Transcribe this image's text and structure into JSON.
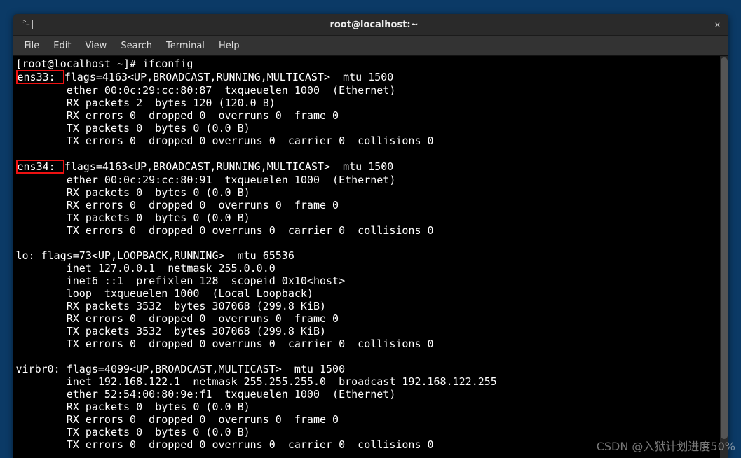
{
  "titlebar": {
    "title": "root@localhost:~"
  },
  "menu": {
    "file": "File",
    "edit": "Edit",
    "view": "View",
    "search": "Search",
    "terminal": "Terminal",
    "help": "Help"
  },
  "term": {
    "prompt": "[root@localhost ~]# ",
    "command": "ifconfig",
    "ens33": {
      "name": "ens33: ",
      "l1": "flags=4163<UP,BROADCAST,RUNNING,MULTICAST>  mtu 1500",
      "l2": "        ether 00:0c:29:cc:80:87  txqueuelen 1000  (Ethernet)",
      "l3": "        RX packets 2  bytes 120 (120.0 B)",
      "l4": "        RX errors 0  dropped 0  overruns 0  frame 0",
      "l5": "        TX packets 0  bytes 0 (0.0 B)",
      "l6": "        TX errors 0  dropped 0 overruns 0  carrier 0  collisions 0"
    },
    "ens34": {
      "name": "ens34: ",
      "l1": "flags=4163<UP,BROADCAST,RUNNING,MULTICAST>  mtu 1500",
      "l2": "        ether 00:0c:29:cc:80:91  txqueuelen 1000  (Ethernet)",
      "l3": "        RX packets 0  bytes 0 (0.0 B)",
      "l4": "        RX errors 0  dropped 0  overruns 0  frame 0",
      "l5": "        TX packets 0  bytes 0 (0.0 B)",
      "l6": "        TX errors 0  dropped 0 overruns 0  carrier 0  collisions 0"
    },
    "lo": {
      "l0": "lo: flags=73<UP,LOOPBACK,RUNNING>  mtu 65536",
      "l1": "        inet 127.0.0.1  netmask 255.0.0.0",
      "l2": "        inet6 ::1  prefixlen 128  scopeid 0x10<host>",
      "l3": "        loop  txqueuelen 1000  (Local Loopback)",
      "l4": "        RX packets 3532  bytes 307068 (299.8 KiB)",
      "l5": "        RX errors 0  dropped 0  overruns 0  frame 0",
      "l6": "        TX packets 3532  bytes 307068 (299.8 KiB)",
      "l7": "        TX errors 0  dropped 0 overruns 0  carrier 0  collisions 0"
    },
    "virbr0": {
      "l0": "virbr0: flags=4099<UP,BROADCAST,MULTICAST>  mtu 1500",
      "l1": "        inet 192.168.122.1  netmask 255.255.255.0  broadcast 192.168.122.255",
      "l2": "        ether 52:54:00:80:9e:f1  txqueuelen 1000  (Ethernet)",
      "l3": "        RX packets 0  bytes 0 (0.0 B)",
      "l4": "        RX errors 0  dropped 0  overruns 0  frame 0",
      "l5": "        TX packets 0  bytes 0 (0.0 B)",
      "l6": "        TX errors 0  dropped 0 overruns 0  carrier 0  collisions 0"
    }
  },
  "watermark": "CSDN @入狱计划进度50%"
}
